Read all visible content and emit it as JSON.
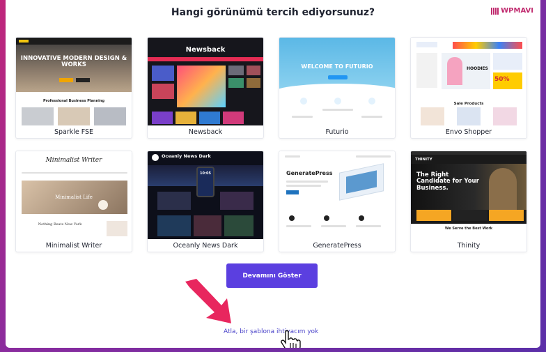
{
  "header": {
    "title": "Hangi görünümü tercih ediyorsunuz?",
    "logo_text": "WPMAVI"
  },
  "templates": [
    {
      "name": "Sparkle FSE",
      "hero": "INNOVATIVE MODERN DESIGN & WORKS",
      "sub": "Professional Business Planning"
    },
    {
      "name": "Newsback",
      "hero": "Newsback"
    },
    {
      "name": "Futurio",
      "hero": "WELCOME TO FUTURIO"
    },
    {
      "name": "Envo Shopper",
      "hero": "HOODIES",
      "promo": "50%",
      "sub": "Sale Products"
    },
    {
      "name": "Minimalist Writer",
      "hero": "Minimalist Writer",
      "sub": "Minimalist Life",
      "foot": "Nothing Beats New York"
    },
    {
      "name": "Oceanly News Dark",
      "hero": "Oceanly News Dark",
      "clock": "10:05"
    },
    {
      "name": "GeneratePress",
      "hero": "GeneratePress"
    },
    {
      "name": "Thinity",
      "hero": "The Right Candidate for Your Business.",
      "sub": "We Serve the Best Work",
      "brand": "THINITY"
    }
  ],
  "actions": {
    "show_more": "Devamını Göster",
    "skip": "Atla, bir şablona ihtiyacım yok"
  },
  "colors": {
    "primary_button": "#5b3fe0",
    "link": "#4a43c9",
    "arrow": "#e8265e"
  }
}
